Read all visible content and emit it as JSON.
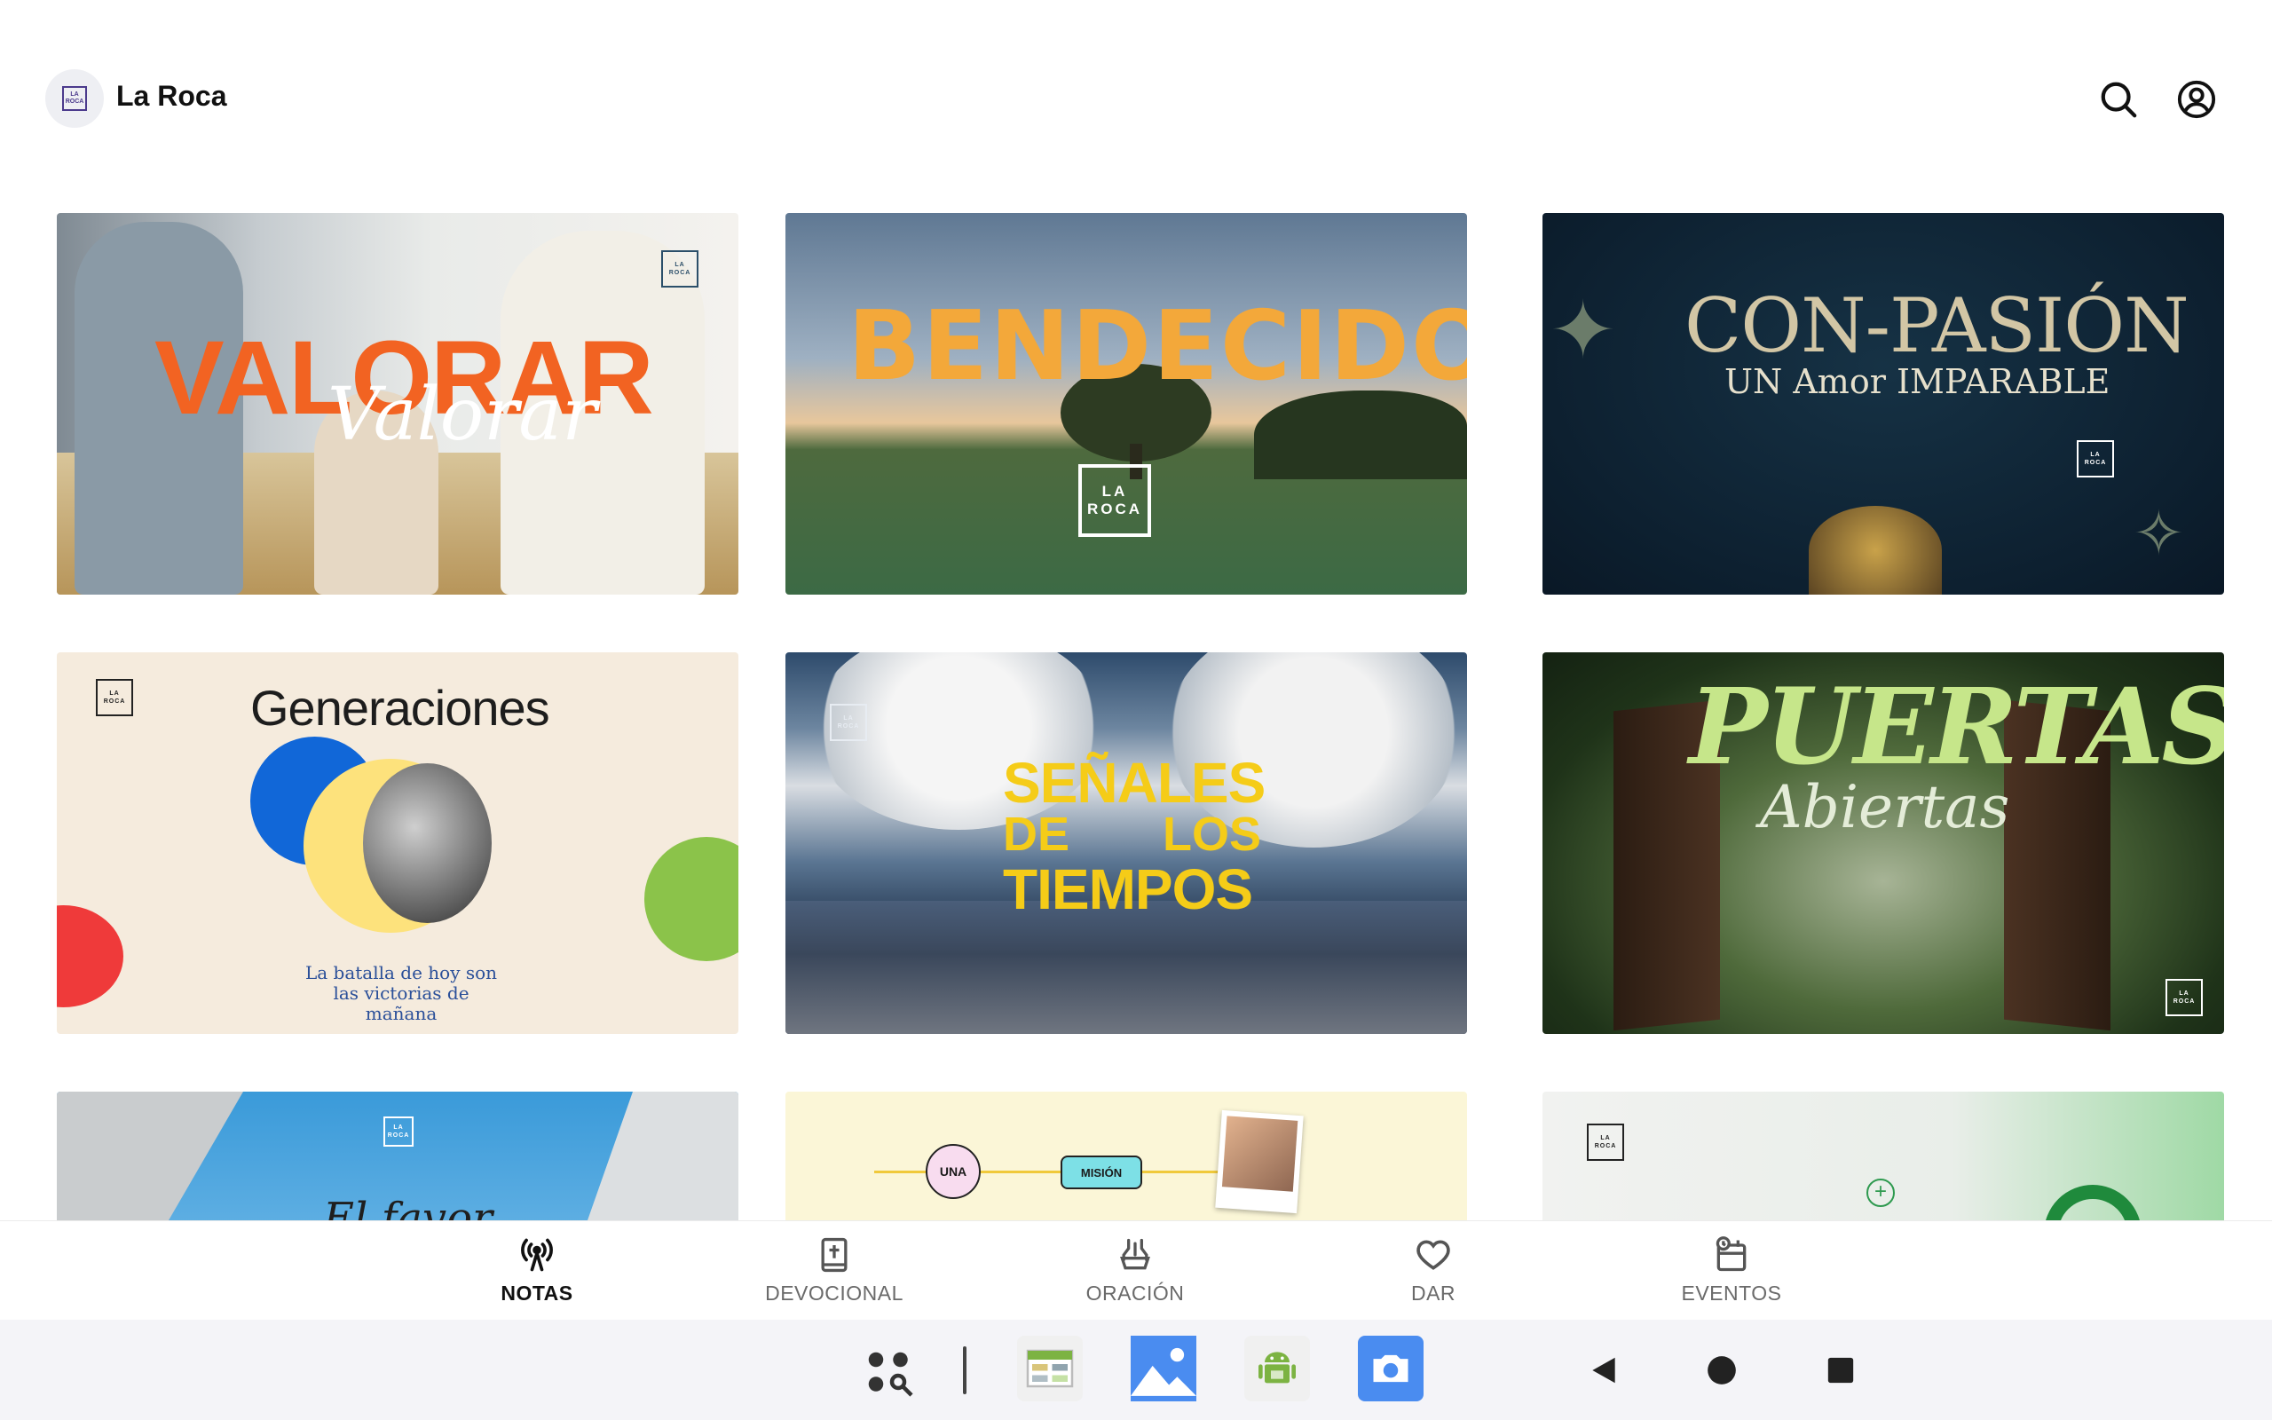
{
  "header": {
    "title": "La Roca",
    "logo_lines": [
      "LA",
      "ROCA"
    ]
  },
  "brand_mark": [
    "LA",
    "ROCA"
  ],
  "cards": [
    {
      "id": "valorar",
      "title": "VALORAR",
      "subtitle": "Valorar"
    },
    {
      "id": "bendecidos",
      "title": "BENDECIDOS"
    },
    {
      "id": "con-pasion",
      "title": "CON-PASIÓN",
      "subtitle": "UN Amor IMPARABLE"
    },
    {
      "id": "generaciones",
      "title": "Generaciones",
      "subtitle": "La batalla de hoy son las victorias de mañana"
    },
    {
      "id": "senales",
      "title_lines": [
        "SEÑALES",
        "DE",
        "LOS",
        "TIEMPOS"
      ]
    },
    {
      "id": "puertas",
      "title": "PUERTAS",
      "subtitle": "Abiertas"
    },
    {
      "id": "el-favor",
      "title": "El favor"
    },
    {
      "id": "una-mision",
      "chips": [
        "UNA",
        "MISIÓN"
      ]
    },
    {
      "id": "green-card",
      "title": ""
    }
  ],
  "bottom_nav": [
    {
      "label": "NOTAS",
      "icon": "broadcast-icon",
      "active": true
    },
    {
      "label": "DEVOCIONAL",
      "icon": "bible-icon",
      "active": false
    },
    {
      "label": "ORACIÓN",
      "icon": "praying-hands-icon",
      "active": false
    },
    {
      "label": "DAR",
      "icon": "heart-icon",
      "active": false
    },
    {
      "label": "EVENTOS",
      "icon": "calendar-clock-icon",
      "active": false
    }
  ],
  "system_bar": {
    "apps": [
      "app-drawer-icon",
      "sheets-app-icon",
      "gallery-app-icon",
      "android-app-icon",
      "camera-app-icon"
    ],
    "nav": [
      "back-icon",
      "home-icon",
      "recents-icon"
    ]
  },
  "colors": {
    "accent_orange": "#f26322",
    "gold": "#f3a83a",
    "yellow": "#f5cc18",
    "green": "#c6e68a"
  }
}
